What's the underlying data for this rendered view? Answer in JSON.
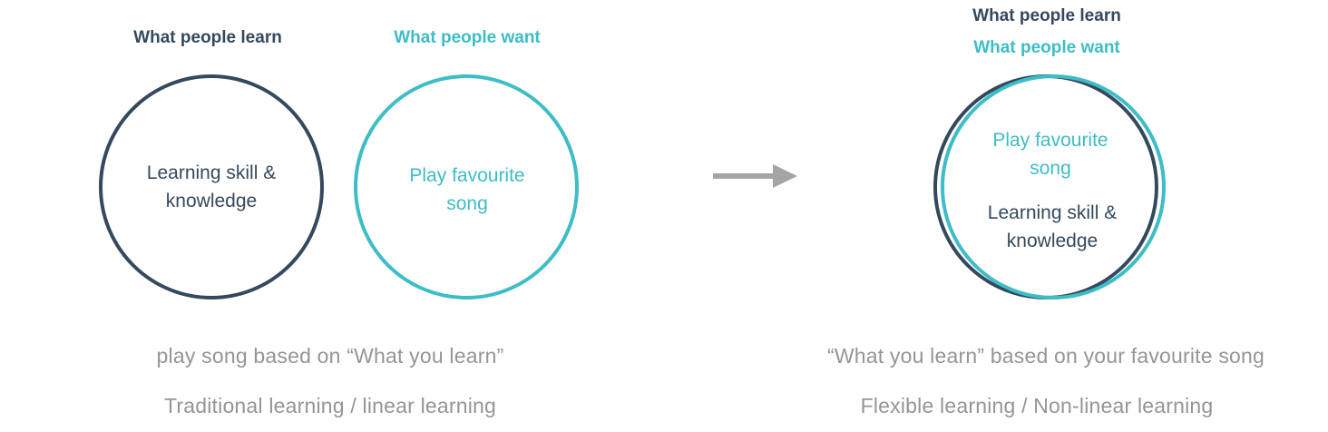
{
  "colors": {
    "dark": "#34495e",
    "teal": "#3dbdc6",
    "grey": "#959595",
    "arrow": "#a5a5a5"
  },
  "left": {
    "learn_heading": "What people learn",
    "want_heading": "What people want",
    "learn_circle_text": [
      "Learning skill &",
      "knowledge"
    ],
    "want_circle_text": [
      "Play favourite",
      "song"
    ],
    "caption_1": "play song based on “What you learn”",
    "caption_2": "Traditional learning / linear learning"
  },
  "arrow": {
    "icon": "right-arrow-icon"
  },
  "right": {
    "learn_heading": "What people learn",
    "want_heading": "What people want",
    "want_circle_text": [
      "Play favourite",
      "song"
    ],
    "learn_circle_text": [
      "Learning skill &",
      "knowledge"
    ],
    "caption_1": "“What you learn” based on your favourite song",
    "caption_2": "Flexible learning / Non-linear learning"
  }
}
